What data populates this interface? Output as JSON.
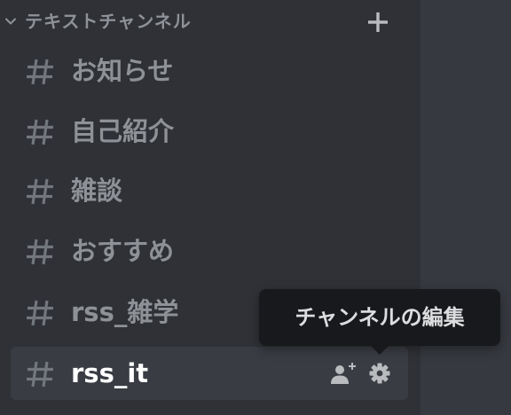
{
  "category": {
    "label": "テキストチャンネル",
    "chevron_icon": "chevron-down-icon",
    "add_icon": "plus-icon"
  },
  "channels": [
    {
      "name": "お知らせ",
      "icon": "hash-icon",
      "active": false
    },
    {
      "name": "自己紹介",
      "icon": "hash-icon",
      "active": false
    },
    {
      "name": "雑談",
      "icon": "hash-icon",
      "active": false
    },
    {
      "name": "おすすめ",
      "icon": "hash-icon",
      "active": false
    },
    {
      "name": "rss_雑学",
      "icon": "hash-icon",
      "active": false
    },
    {
      "name": "rss_it",
      "icon": "hash-icon",
      "active": true
    }
  ],
  "active_channel_actions": {
    "invite_icon": "add-member-icon",
    "settings_icon": "gear-icon"
  },
  "tooltip": {
    "text": "チャンネルの編集"
  },
  "colors": {
    "sidebar_bg": "#2f3136",
    "main_bg": "#36393f",
    "muted_text": "#8e9297",
    "active_text": "#ffffff",
    "active_row_bg": "#393c43",
    "tooltip_bg": "#18191c"
  }
}
